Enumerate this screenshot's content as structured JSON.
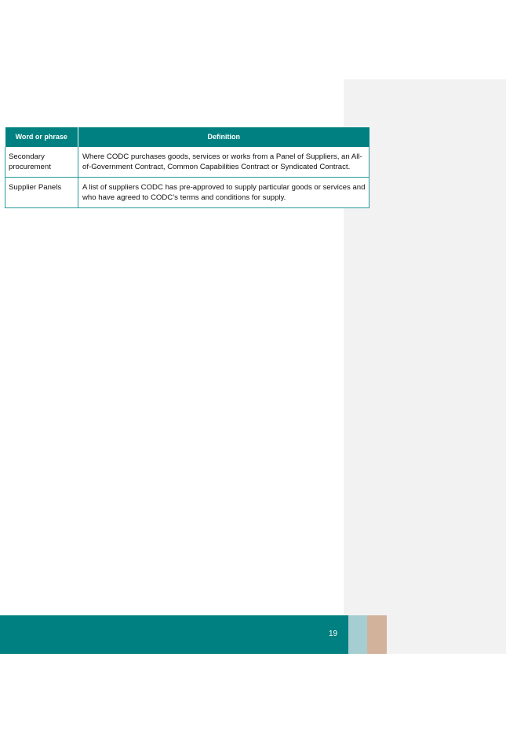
{
  "table": {
    "headers": [
      "Word or phrase",
      "Definition"
    ],
    "rows": [
      {
        "term": "Secondary procurement",
        "definition": "Where CODC purchases goods, services or works from a Panel of Suppliers, an All-of-Government Contract, Common Capabilities Contract or Syndicated Contract."
      },
      {
        "term": "Supplier Panels",
        "definition": "A list of suppliers CODC has pre-approved to supply particular goods or services and who have agreed to CODC’s terms and conditions for supply."
      }
    ]
  },
  "footer": {
    "page_number": "19"
  },
  "colors": {
    "brand_teal": "#008080",
    "swatch_blue": "#a6cdd1",
    "swatch_tan": "#d3b29b",
    "comment_pane": "#f2f2f2"
  }
}
